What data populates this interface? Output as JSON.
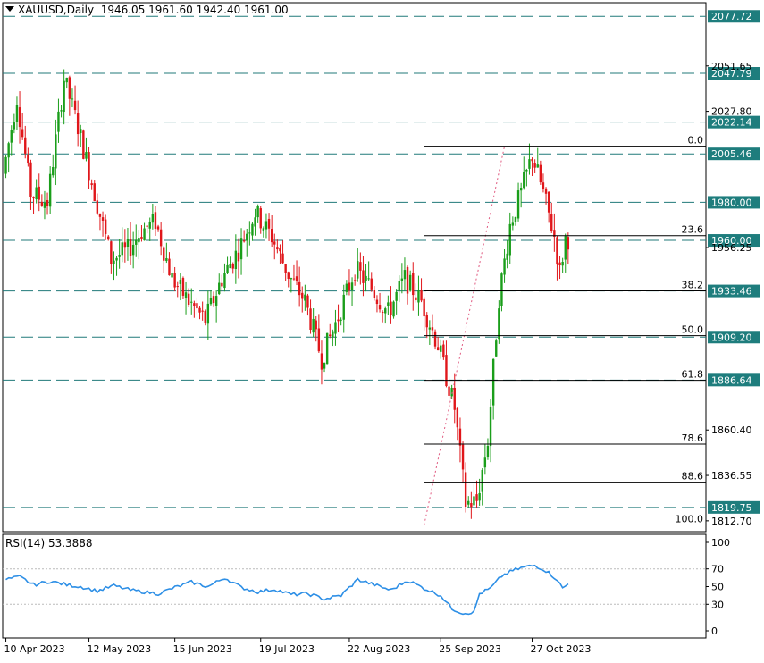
{
  "header": {
    "symbol": "XAUUSD",
    "timeframe": "Daily",
    "ohlc": "1946.05 1961.60 1942.40 1961.00"
  },
  "rsi": {
    "label": "RSI(14) 53.3888",
    "levels": [
      70,
      30
    ],
    "ticks": [
      100,
      70,
      50,
      30,
      0
    ]
  },
  "colors": {
    "bull": "#1a9e1a",
    "bear": "#e0161a",
    "level_line": "#217a7a",
    "level_label_bg": "#1e7d7d",
    "rsi_line": "#2d8fe6",
    "fib_line": "#000000"
  },
  "chart_data": {
    "type": "candlestick",
    "title": "XAUUSD,Daily",
    "y_axis_ticks": [
      "2051.65",
      "2027.80",
      "1956.25",
      "1860.40",
      "1836.55",
      "1812.70"
    ],
    "x_axis_ticks": [
      "10 Apr 2023",
      "12 May 2023",
      "15 Jun 2023",
      "19 Jul 2023",
      "22 Aug 2023",
      "25 Sep 2023",
      "27 Oct 2023"
    ],
    "ylim": [
      1807,
      2083
    ],
    "horizontal_levels": [
      2077.72,
      2047.79,
      2022.14,
      2005.46,
      1980.0,
      1960.0,
      1933.46,
      1909.2,
      1886.64,
      1819.75
    ],
    "fibonacci": {
      "high": 2009.5,
      "low": 1810.5,
      "levels": [
        {
          "label": "0.0",
          "value": 2009.5
        },
        {
          "label": "23.6",
          "value": 1962.5
        },
        {
          "label": "38.2",
          "value": 1933.5
        },
        {
          "label": "50.0",
          "value": 1910.0
        },
        {
          "label": "61.8",
          "value": 1886.5
        },
        {
          "label": "78.6",
          "value": 1853.0
        },
        {
          "label": "88.6",
          "value": 1833.0
        },
        {
          "label": "100.0",
          "value": 1810.5
        }
      ]
    },
    "price_waypoints": [
      [
        0,
        1995
      ],
      [
        5,
        2035
      ],
      [
        10,
        1985
      ],
      [
        16,
        1980
      ],
      [
        22,
        2045
      ],
      [
        27,
        2020
      ],
      [
        33,
        1985
      ],
      [
        39,
        1950
      ],
      [
        45,
        1955
      ],
      [
        50,
        1965
      ],
      [
        55,
        1970
      ],
      [
        61,
        1940
      ],
      [
        67,
        1928
      ],
      [
        73,
        1918
      ],
      [
        79,
        1940
      ],
      [
        85,
        1955
      ],
      [
        91,
        1975
      ],
      [
        97,
        1962
      ],
      [
        103,
        1942
      ],
      [
        109,
        1928
      ],
      [
        115,
        1898
      ],
      [
        121,
        1920
      ],
      [
        127,
        1945
      ],
      [
        133,
        1935
      ],
      [
        139,
        1922
      ],
      [
        145,
        1940
      ],
      [
        151,
        1928
      ],
      [
        157,
        1905
      ],
      [
        163,
        1872
      ],
      [
        167,
        1822
      ],
      [
        171,
        1823
      ],
      [
        175,
        1855
      ],
      [
        179,
        1930
      ],
      [
        183,
        1968
      ],
      [
        187,
        1985
      ],
      [
        191,
        2005
      ],
      [
        195,
        1985
      ],
      [
        199,
        1962
      ],
      [
        201,
        1943
      ],
      [
        203,
        1961
      ]
    ],
    "rsi_waypoints": [
      [
        0,
        58
      ],
      [
        5,
        61
      ],
      [
        10,
        52
      ],
      [
        16,
        56
      ],
      [
        22,
        52
      ],
      [
        27,
        50
      ],
      [
        33,
        45
      ],
      [
        39,
        51
      ],
      [
        45,
        46
      ],
      [
        50,
        44
      ],
      [
        55,
        42
      ],
      [
        61,
        49
      ],
      [
        67,
        55
      ],
      [
        73,
        50
      ],
      [
        79,
        60
      ],
      [
        85,
        49
      ],
      [
        91,
        44
      ],
      [
        97,
        47
      ],
      [
        103,
        41
      ],
      [
        109,
        42
      ],
      [
        115,
        36
      ],
      [
        121,
        40
      ],
      [
        127,
        58
      ],
      [
        133,
        52
      ],
      [
        139,
        46
      ],
      [
        145,
        57
      ],
      [
        151,
        48
      ],
      [
        157,
        40
      ],
      [
        161,
        25
      ],
      [
        165,
        20
      ],
      [
        169,
        21
      ],
      [
        171,
        42
      ],
      [
        175,
        48
      ],
      [
        179,
        62
      ],
      [
        183,
        68
      ],
      [
        187,
        72
      ],
      [
        191,
        74
      ],
      [
        195,
        68
      ],
      [
        199,
        58
      ],
      [
        201,
        48
      ],
      [
        203,
        53
      ]
    ],
    "candle_count": 204
  }
}
